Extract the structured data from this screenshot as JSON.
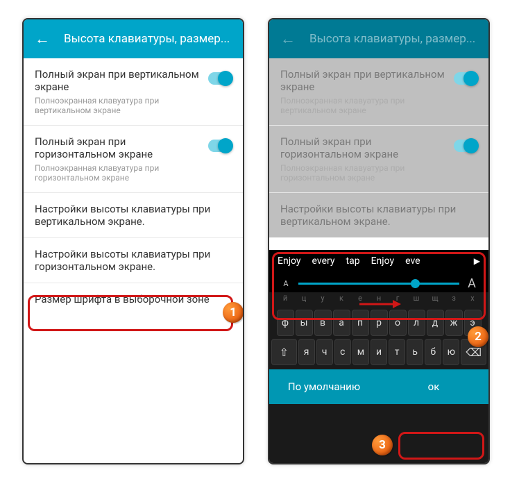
{
  "header": {
    "title": "Высота клавиатуры, размер..."
  },
  "settings": {
    "vertical_full": {
      "title": "Полный экран при вертикальном экране",
      "sub": "Полноэкранная клавуатура при вертикальном экране"
    },
    "horizontal_full": {
      "title": "Полный экран при горизонтальном экране",
      "sub": "Полноэкранная клавуатура при горизонтальном экране"
    },
    "height_vertical": {
      "title": "Настройки высоты клавиатуры при вертикальном экране."
    },
    "height_horizontal": {
      "title": "Настройки высоты клавиатуры при горизонтальном экране."
    },
    "font_size": {
      "title": "Размер шрифта в выборочной зоне"
    }
  },
  "suggestions": [
    "Enjoy",
    "every",
    "tap",
    "Enjoy",
    "eve"
  ],
  "slider": {
    "small": "A",
    "big": "A"
  },
  "preview_letters": [
    "й",
    "ц",
    "у",
    "к",
    "е",
    "н",
    "г",
    "ш",
    "щ",
    "з",
    "х"
  ],
  "rows": {
    "r1": [
      "ф",
      "ы",
      "в",
      "а",
      "п",
      "р",
      "о",
      "л",
      "д",
      "ж",
      "э"
    ],
    "r2_head": "⇧",
    "r2": [
      "я",
      "ч",
      "с",
      "м",
      "и",
      "т",
      "ь",
      "б",
      "ю"
    ],
    "r2_tail": "⌫"
  },
  "actions": {
    "default": "По умолчанию",
    "ok": "ок"
  },
  "badges": {
    "b1": "1",
    "b2": "2",
    "b3": "3"
  },
  "arrow_icon": "▶"
}
